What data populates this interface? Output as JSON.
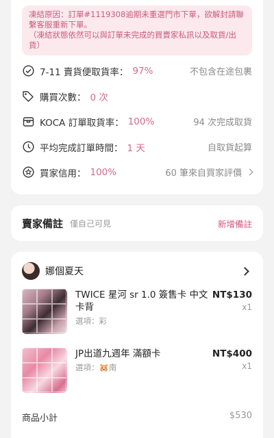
{
  "alert": {
    "reason": "凍結原因：訂單#1119308逾期未重選門市下單，欲解封請聯繫客服重新下單。",
    "note": "（凍結狀態依然可以與訂單未完成的買賣家私訊以及取貨/出貨）"
  },
  "stats": [
    {
      "icon": "check-circle-icon",
      "label": "7-11 賣貨便取貨率：",
      "value": "97%",
      "right": "不包含在途包裹"
    },
    {
      "icon": "tag-icon",
      "label": "購買次數：",
      "value": "0 次",
      "right": ""
    },
    {
      "icon": "box-icon",
      "label": "KOCA 訂單取貨率：",
      "value": "100%",
      "right": "94 次完成取貨"
    },
    {
      "icon": "clock-icon",
      "label": "平均完成訂單時間：",
      "value": "1 天",
      "right": "自取貨起算"
    },
    {
      "icon": "star-circle-icon",
      "label": "買家信用：",
      "value": "100%",
      "right": "60 筆來自買家評價"
    }
  ],
  "seller_note": {
    "title": "賣家備註",
    "subtitle": "僅自己可見",
    "action": "新增備註"
  },
  "order": {
    "shop_name": "娜個夏天",
    "items": [
      {
        "title": "TWICE 星河 sr 1.0 簽售卡 中文卡背",
        "option": "選項：彩",
        "price": "NT$130",
        "qty": "x1"
      },
      {
        "title": "JP出道九週年 滿額卡",
        "option": "選項：🐹南",
        "price": "NT$400",
        "qty": "x1"
      }
    ],
    "subtotal_label": "商品小計",
    "subtotal_value": "$530"
  }
}
